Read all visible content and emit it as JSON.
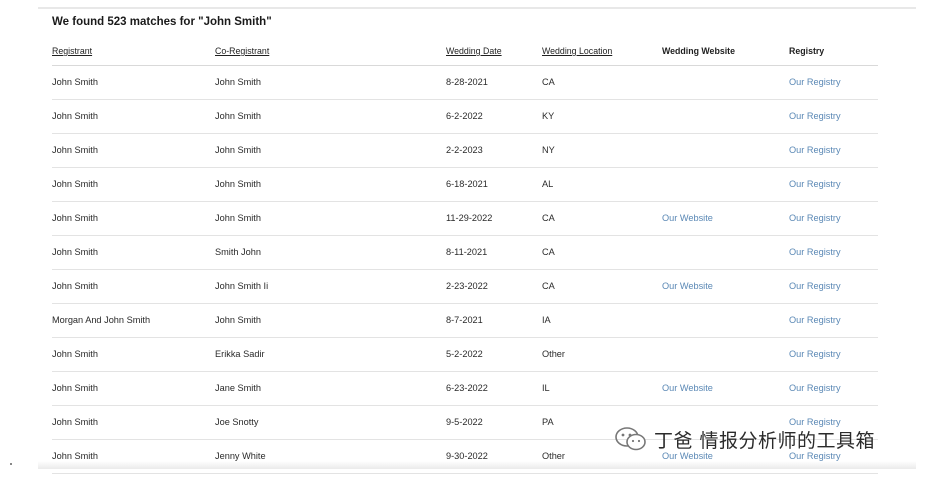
{
  "heading": "We found 523 matches for \"John Smith\"",
  "columns": {
    "registrant": "Registrant",
    "co_registrant": "Co-Registrant",
    "wedding_date": "Wedding Date",
    "wedding_location": "Wedding Location",
    "wedding_website": "Wedding Website",
    "registry": "Registry"
  },
  "rows": [
    {
      "registrant": "John Smith",
      "co_registrant": "John Smith",
      "date": "8-28-2021",
      "location": "CA",
      "website": "",
      "registry": "Our Registry"
    },
    {
      "registrant": "John Smith",
      "co_registrant": "John Smith",
      "date": "6-2-2022",
      "location": "KY",
      "website": "",
      "registry": "Our Registry"
    },
    {
      "registrant": "John Smith",
      "co_registrant": "John Smith",
      "date": "2-2-2023",
      "location": "NY",
      "website": "",
      "registry": "Our Registry"
    },
    {
      "registrant": "John Smith",
      "co_registrant": "John Smith",
      "date": "6-18-2021",
      "location": "AL",
      "website": "",
      "registry": "Our Registry"
    },
    {
      "registrant": "John Smith",
      "co_registrant": "John Smith",
      "date": "11-29-2022",
      "location": "CA",
      "website": "Our Website",
      "registry": "Our Registry"
    },
    {
      "registrant": "John Smith",
      "co_registrant": "Smith John",
      "date": "8-11-2021",
      "location": "CA",
      "website": "",
      "registry": "Our Registry"
    },
    {
      "registrant": "John Smith",
      "co_registrant": "John Smith Ii",
      "date": "2-23-2022",
      "location": "CA",
      "website": "Our Website",
      "registry": "Our Registry"
    },
    {
      "registrant": "Morgan And John Smith",
      "co_registrant": "John Smith",
      "date": "8-7-2021",
      "location": "IA",
      "website": "",
      "registry": "Our Registry"
    },
    {
      "registrant": "John Smith",
      "co_registrant": "Erikka Sadir",
      "date": "5-2-2022",
      "location": "Other",
      "website": "",
      "registry": "Our Registry"
    },
    {
      "registrant": "John Smith",
      "co_registrant": "Jane Smith",
      "date": "6-23-2022",
      "location": "IL",
      "website": "Our Website",
      "registry": "Our Registry"
    },
    {
      "registrant": "John Smith",
      "co_registrant": "Joe Snotty",
      "date": "9-5-2022",
      "location": "PA",
      "website": "",
      "registry": "Our Registry"
    },
    {
      "registrant": "John Smith",
      "co_registrant": "Jenny White",
      "date": "9-30-2022",
      "location": "Other",
      "website": "Our Website",
      "registry": "Our Registry"
    }
  ],
  "watermark": {
    "text": "丁爸 情报分析师的工具箱",
    "icon": "wechat-icon"
  },
  "colors": {
    "link": "#5a88b5",
    "text": "#2a2a2a",
    "divider": "#e3e3e3"
  }
}
